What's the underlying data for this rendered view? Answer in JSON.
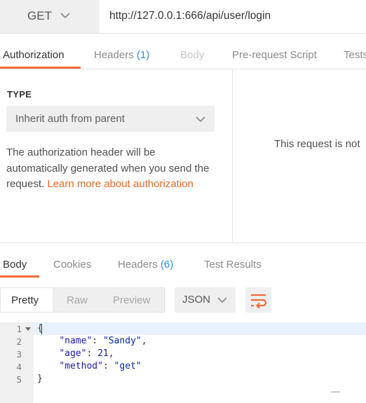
{
  "request": {
    "method": "GET",
    "url": "http://127.0.0.1:666/api/user/login"
  },
  "request_tabs": {
    "authorization": "Authorization",
    "headers": "Headers",
    "headers_count": "(1)",
    "body": "Body",
    "prerequest": "Pre-request Script",
    "tests": "Tests"
  },
  "auth": {
    "type_label": "TYPE",
    "type_value": "Inherit auth from parent",
    "description": "The authorization header will be automatically generated when you send the request. ",
    "link_text": "Learn more about authorization"
  },
  "notice": "This request is not",
  "response_tabs": {
    "body": "Body",
    "cookies": "Cookies",
    "headers": "Headers",
    "headers_count": "(6)",
    "test_results": "Test Results"
  },
  "view": {
    "pretty": "Pretty",
    "raw": "Raw",
    "preview": "Preview",
    "format": "JSON"
  },
  "code": {
    "line_numbers": [
      "1",
      "2",
      "3",
      "4",
      "5"
    ],
    "open_brace": "{",
    "close_brace": "}",
    "name_key": "\"name\"",
    "name_value": "\"Sandy\"",
    "age_key": "\"age\"",
    "age_value": "21",
    "method_key": "\"method\"",
    "method_value": "\"get\""
  },
  "colors": {
    "accent": "#f26b3a",
    "link": "#e56b1f",
    "count": "#2f8fd0"
  },
  "icons": [
    "chevron-down-icon",
    "wrap-lines-icon",
    "fold-arrow-icon"
  ]
}
